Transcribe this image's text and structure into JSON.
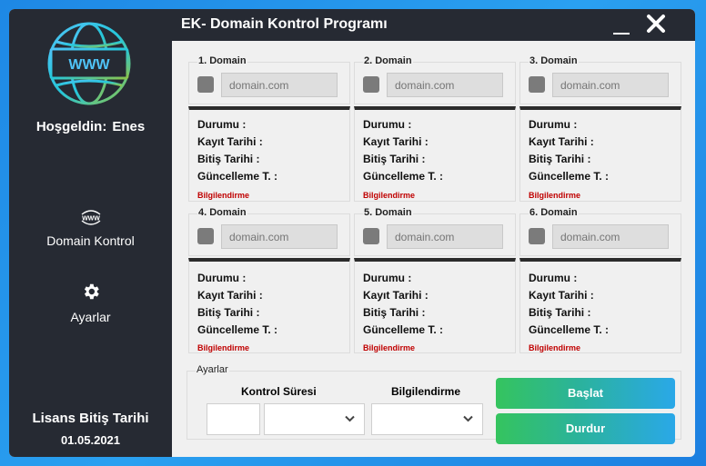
{
  "window": {
    "title": "EK- Domain Kontrol Programı"
  },
  "sidebar": {
    "welcome_label": "Hoşgeldin:",
    "user_name": "Enes",
    "nav": [
      {
        "label": "Domain Kontrol",
        "icon": "www-icon"
      },
      {
        "label": "Ayarlar",
        "icon": "gear-icon"
      }
    ],
    "license_label": "Lisans Bitiş Tarihi",
    "license_date": "01.05.2021"
  },
  "domains": [
    {
      "label": "1. Domain",
      "placeholder": "domain.com",
      "status": "Durumu :",
      "registered": "Kayıt Tarihi :",
      "expiry": "Bitiş Tarihi :",
      "updated": "Güncelleme T. :",
      "notify": "Bilgilendirme"
    },
    {
      "label": "2. Domain",
      "placeholder": "domain.com",
      "status": "Durumu :",
      "registered": "Kayıt Tarihi :",
      "expiry": "Bitiş Tarihi :",
      "updated": "Güncelleme T. :",
      "notify": "Bilgilendirme"
    },
    {
      "label": "3. Domain",
      "placeholder": "domain.com",
      "status": "Durumu :",
      "registered": "Kayıt Tarihi :",
      "expiry": "Bitiş Tarihi :",
      "updated": "Güncelleme T. :",
      "notify": "Bilgilendirme"
    },
    {
      "label": "4. Domain",
      "placeholder": "domain.com",
      "status": "Durumu :",
      "registered": "Kayıt Tarihi :",
      "expiry": "Bitiş Tarihi :",
      "updated": "Güncelleme T. :",
      "notify": "Bilgilendirme"
    },
    {
      "label": "5. Domain",
      "placeholder": "domain.com",
      "status": "Durumu :",
      "registered": "Kayıt Tarihi :",
      "expiry": "Bitiş Tarihi :",
      "updated": "Güncelleme T. :",
      "notify": "Bilgilendirme"
    },
    {
      "label": "6. Domain",
      "placeholder": "domain.com",
      "status": "Durumu :",
      "registered": "Kayıt Tarihi :",
      "expiry": "Bitiş Tarihi :",
      "updated": "Güncelleme T. :",
      "notify": "Bilgilendirme"
    }
  ],
  "settings": {
    "legend": "Ayarlar",
    "interval_label": "Kontrol Süresi",
    "notify_label": "Bilgilendirme",
    "start_label": "Başlat",
    "stop_label": "Durdur"
  },
  "colors": {
    "sidebar_bg": "#262a33",
    "accent_green": "#35c45e",
    "accent_blue": "#2aa8e8",
    "info_red": "#c00000"
  }
}
